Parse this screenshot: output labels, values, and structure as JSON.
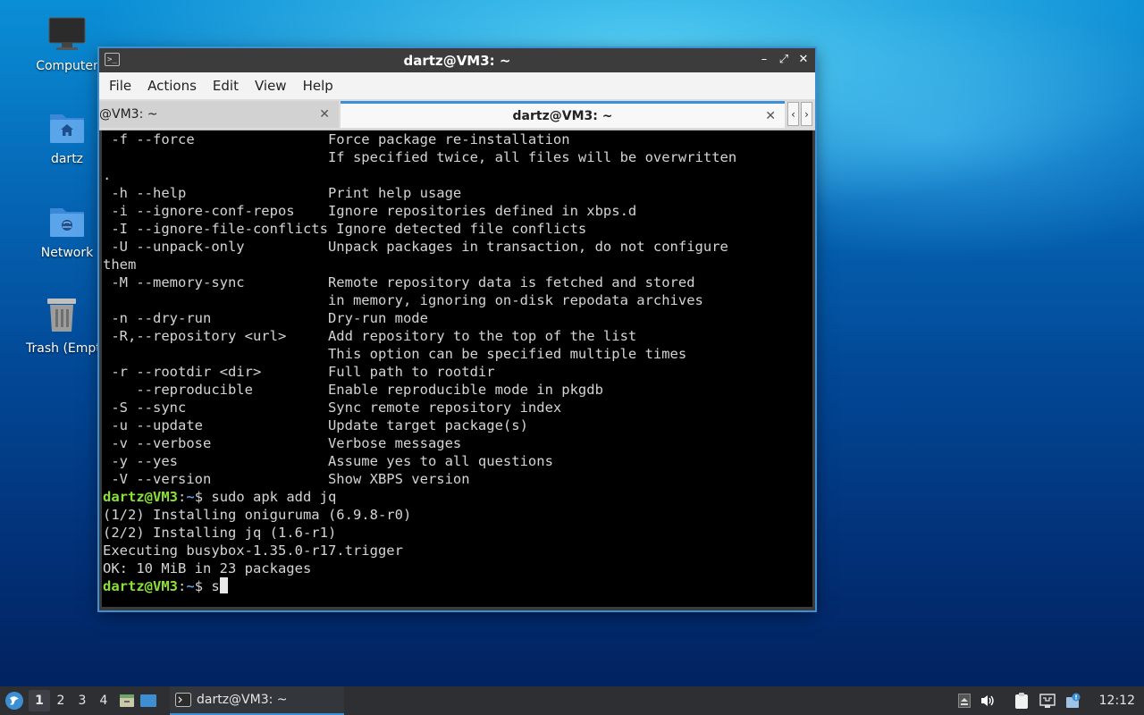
{
  "desktop": {
    "icons": [
      {
        "label": "Computer",
        "icon": "monitor-icon"
      },
      {
        "label": "dartz",
        "icon": "home-folder-icon"
      },
      {
        "label": "Network",
        "icon": "network-folder-icon"
      },
      {
        "label": "Trash (Empty)",
        "icon": "trash-icon"
      }
    ]
  },
  "window": {
    "title": "dartz@VM3: ~",
    "controls": {
      "minimize": "–",
      "maximize": "⤢",
      "close": "✕"
    }
  },
  "menu": [
    "File",
    "Actions",
    "Edit",
    "View",
    "Help"
  ],
  "tabs": [
    {
      "label": "@VM3: ~",
      "active": false,
      "close": "✕"
    },
    {
      "label": "dartz@VM3: ~",
      "active": true,
      "close": "✕"
    }
  ],
  "tab_nav": {
    "left": "‹",
    "right": "›"
  },
  "terminal": {
    "lines": [
      " -f --force                Force package re-installation",
      "                           If specified twice, all files will be overwritten",
      ".",
      " -h --help                 Print help usage",
      " -i --ignore-conf-repos    Ignore repositories defined in xbps.d",
      " -I --ignore-file-conflicts Ignore detected file conflicts",
      " -U --unpack-only          Unpack packages in transaction, do not configure",
      "them",
      " -M --memory-sync          Remote repository data is fetched and stored",
      "                           in memory, ignoring on-disk repodata archives",
      " -n --dry-run              Dry-run mode",
      " -R,--repository <url>     Add repository to the top of the list",
      "                           This option can be specified multiple times",
      " -r --rootdir <dir>        Full path to rootdir",
      "    --reproducible         Enable reproducible mode in pkgdb",
      " -S --sync                 Sync remote repository index",
      " -u --update               Update target package(s)",
      " -v --verbose              Verbose messages",
      " -y --yes                  Assume yes to all questions",
      " -V --version              Show XBPS version"
    ],
    "prompt_user": "dartz@VM3",
    "prompt_sep": ":",
    "prompt_path": "~",
    "prompt_symbol": "$ ",
    "command1": "sudo apk add jq",
    "output": [
      "(1/2) Installing oniguruma (6.9.8-r0)",
      "(2/2) Installing jq (1.6-r1)",
      "Executing busybox-1.35.0-r17.trigger",
      "OK: 10 MiB in 23 packages"
    ],
    "current_input": "s"
  },
  "taskbar": {
    "workspaces": [
      "1",
      "2",
      "3",
      "4"
    ],
    "task_label": "dartz@VM3: ~",
    "clock": "12:12"
  }
}
